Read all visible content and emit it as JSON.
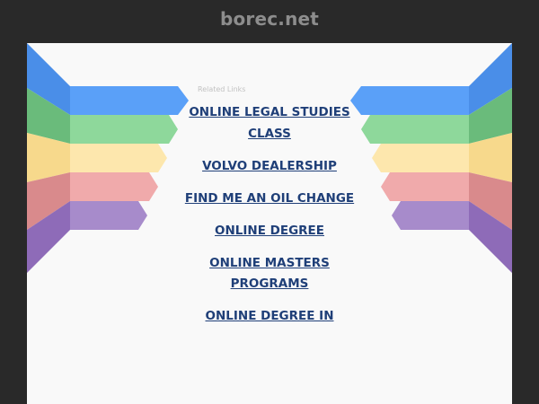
{
  "header": {
    "site_name": "borec.net"
  },
  "main": {
    "related_label": "Related Links",
    "links": [
      "ONLINE LEGAL STUDIES CLASS",
      "VOLVO DEALERSHIP",
      "FIND ME AN OIL CHANGE",
      "ONLINE DEGREE",
      "ONLINE MASTERS PROGRAMS",
      "ONLINE DEGREE IN"
    ]
  },
  "colors": {
    "background": "#292929",
    "panel": "#f9f9f9",
    "link": "#1f3f78",
    "ribbon_blue": "#5aa0f8",
    "ribbon_green": "#7ccf8c",
    "ribbon_yellow": "#fde5a0",
    "ribbon_red": "#e59a9c",
    "ribbon_purple": "#9a7bc2"
  }
}
